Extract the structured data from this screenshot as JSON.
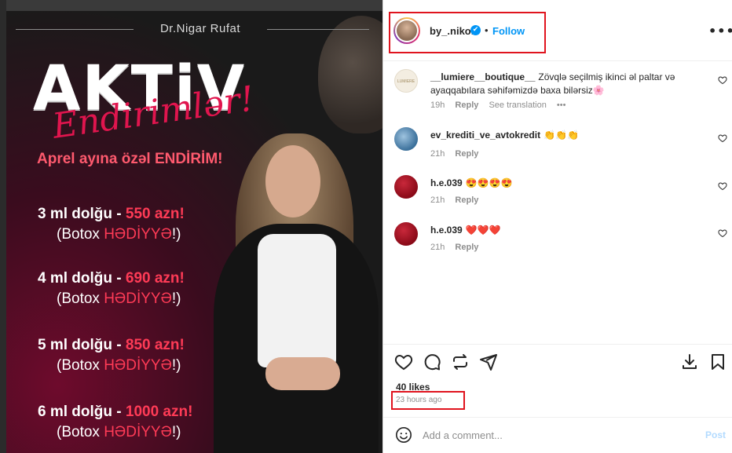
{
  "post_image": {
    "brand": "Dr.Nigar Rufat",
    "headline": "AKTiV",
    "script_text": "Endirimlər!",
    "promo_line": "Aprel ayına özəl ENDİRİM!",
    "offers": [
      {
        "line1_prefix": "3 ml dolğu - ",
        "price": "550 azn!",
        "gift_prefix": "(Botox ",
        "gift": "HƏDİYYƏ",
        "gift_suffix": "!)"
      },
      {
        "line1_prefix": "4 ml dolğu - ",
        "price": "690 azn!",
        "gift_prefix": "(Botox ",
        "gift": "HƏDİYYƏ",
        "gift_suffix": "!)"
      },
      {
        "line1_prefix": "5 ml dolğu - ",
        "price": "850 azn!",
        "gift_prefix": "(Botox ",
        "gift": "HƏDİYYƏ",
        "gift_suffix": "!)"
      },
      {
        "line1_prefix": "6 ml dolğu - ",
        "price": "1000 azn!",
        "gift_prefix": "(Botox ",
        "gift": "HƏDİYYƏ",
        "gift_suffix": "!)"
      }
    ]
  },
  "header": {
    "username": "by_.nikol",
    "verified_icon": "✔",
    "separator": "•",
    "follow_label": "Follow",
    "more_label": "•••"
  },
  "comments": [
    {
      "user": "__lumiere__boutique__",
      "text": "Zövqlə seçilmiş ikinci əl paltar və ayaqqabılara səhifəmizdə baxa bilərsiz🌸",
      "time": "19h",
      "reply": "Reply",
      "translate": "See translation",
      "more": "•••",
      "avatar_text": "LUMIERE",
      "avatar_color": "#f3ede1"
    },
    {
      "user": "ev_krediti_ve_avtokredit",
      "text": "👏👏👏",
      "time": "21h",
      "reply": "Reply",
      "avatar_color": "#3a6f9a"
    },
    {
      "user": "h.e.039",
      "text": "😍😍😍😍",
      "time": "21h",
      "reply": "Reply",
      "avatar_color": "#a01020"
    },
    {
      "user": "h.e.039",
      "text": "❤️❤️❤️",
      "time": "21h",
      "reply": "Reply",
      "avatar_color": "#a01020"
    }
  ],
  "footer": {
    "likes": "40 likes",
    "time_ago": "23 hours ago",
    "comment_placeholder": "Add a comment...",
    "post_label": "Post"
  },
  "colors": {
    "accent": "#0095f6",
    "highlight_box": "#e0141e",
    "promo_red": "#ff3b56"
  }
}
